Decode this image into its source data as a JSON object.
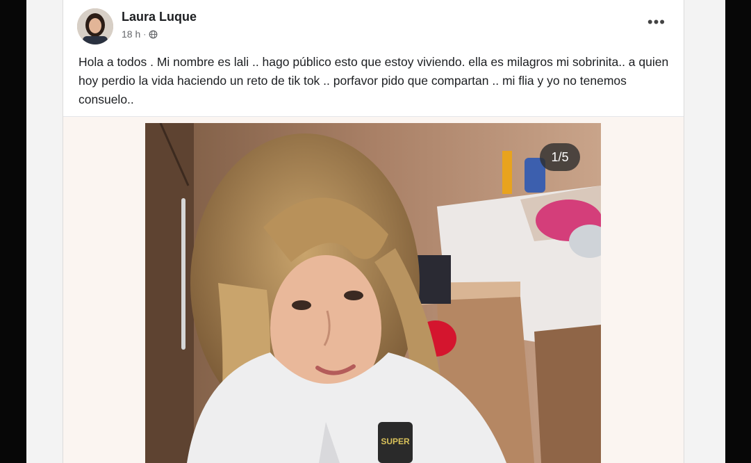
{
  "post": {
    "author": "Laura Luque",
    "time": "18 h",
    "privacy_icon": "globe-icon",
    "more_label": "•••",
    "text": "Hola a todos . Mi nombre es lali .. hago público  esto que estoy viviendo.  ella es milagros mi sobrinita.. a quien hoy perdio la vida haciendo un reto de tik tok .. porfavor pido que compartan .. mi flia y yo no tenemos consuelo.."
  },
  "photo": {
    "counter": "1/5",
    "shirt_logo": "SUPER"
  },
  "colors": {
    "text": "#1c1e21",
    "secondary": "#65676b",
    "card_bg": "#ffffff",
    "photo_bg": "#fbf5f1"
  }
}
